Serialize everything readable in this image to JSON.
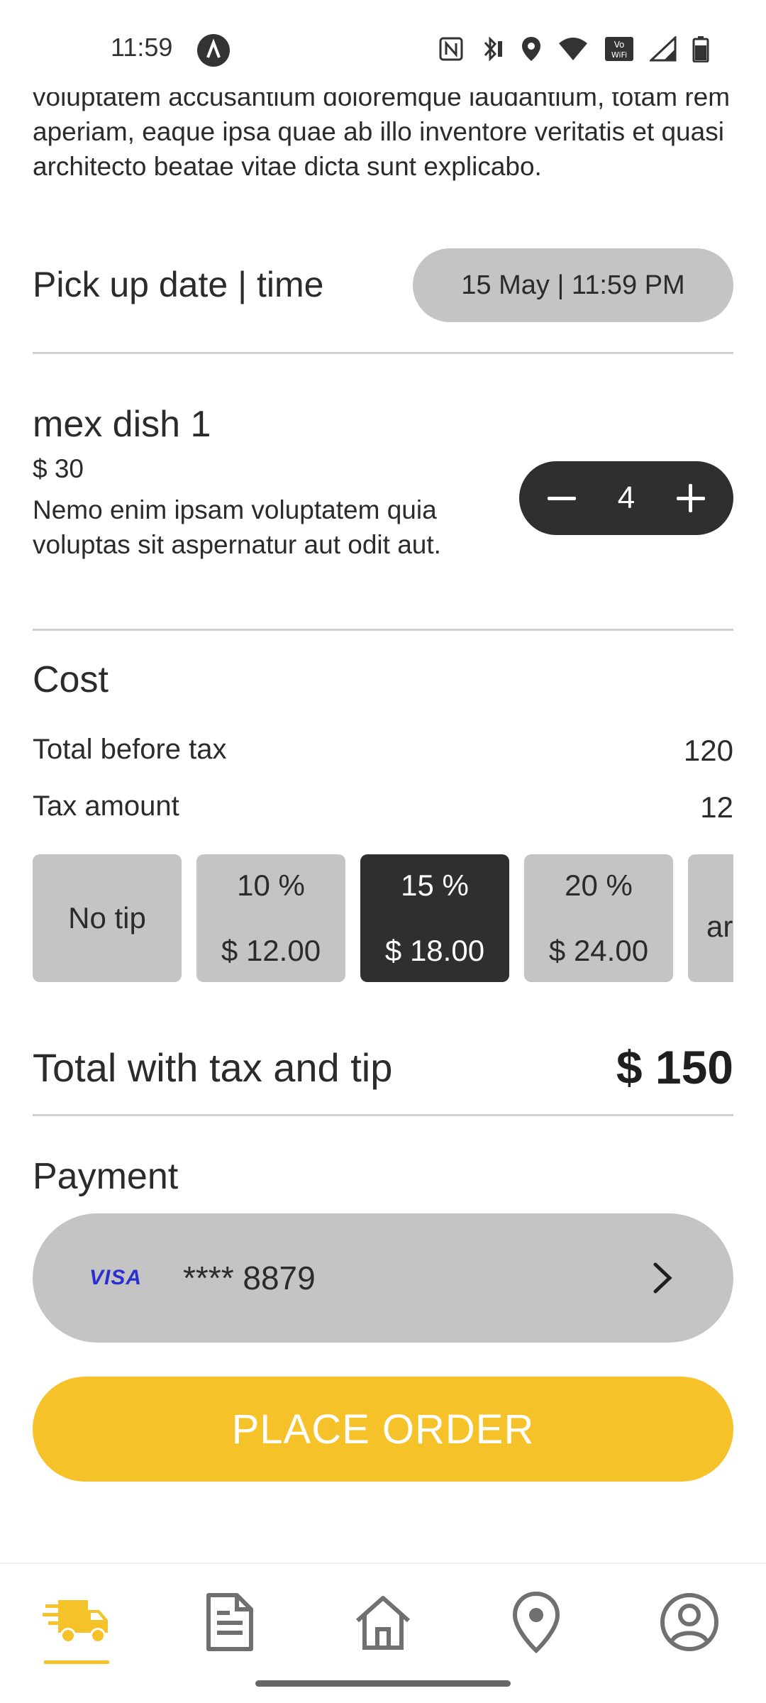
{
  "status_bar": {
    "time": "11:59",
    "icons": [
      "nfc-icon",
      "bluetooth-icon",
      "location-icon",
      "wifi-icon",
      "vowifi-icon",
      "signal-icon",
      "battery-icon"
    ]
  },
  "intro": {
    "text": "voluptatem accusantium doloremque laudantium, totam rem aperiam, eaque ipsa quae ab illo inventore veritatis et quasi architecto beatae vitae dicta sunt explicabo."
  },
  "pickup": {
    "label": "Pick up date | time",
    "value": "15 May  |  11:59 PM"
  },
  "dish": {
    "title": "mex dish 1",
    "price": "$ 30",
    "description": "Nemo enim ipsam voluptatem quia voluptas sit aspernatur aut odit aut.",
    "quantity": "4"
  },
  "cost": {
    "heading": "Cost",
    "rows": [
      {
        "label": "Total before tax",
        "value": "120"
      },
      {
        "label": "Tax amount",
        "value": "12"
      }
    ]
  },
  "tips": [
    {
      "label": "No tip",
      "amount": ""
    },
    {
      "label": "10 %",
      "amount": "$ 12.00"
    },
    {
      "label": "15 %",
      "amount": "$ 18.00"
    },
    {
      "label": "20 %",
      "amount": "$ 24.00"
    },
    {
      "label": "",
      "amount": "ar"
    }
  ],
  "selected_tip": "15 %",
  "total": {
    "label": "Total with tax and tip",
    "value": "$ 150"
  },
  "payment": {
    "heading": "Payment",
    "brand": "VISA",
    "card": "**** 8879"
  },
  "place_order": {
    "label": "PLACE ORDER"
  },
  "nav": {
    "items": [
      "delivery-truck-icon",
      "orders-document-icon",
      "home-icon",
      "location-pin-icon",
      "account-icon"
    ],
    "active": "delivery-truck-icon"
  },
  "colors": {
    "accent": "#f6c22a",
    "pill_gray": "#c4c4c4",
    "dark": "#2f2f2f",
    "visa_blue": "#2a2fcf"
  }
}
